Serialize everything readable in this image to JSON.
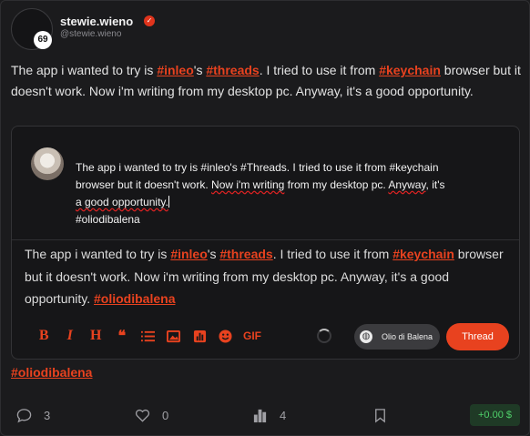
{
  "author": {
    "username": "stewie.wieno",
    "handle": "@stewie.wieno",
    "reputation": "69",
    "verified_icon": "verified-check-icon"
  },
  "post": {
    "segments": [
      {
        "text": "The app i wanted to try is ",
        "tag": false
      },
      {
        "text": "#inleo",
        "tag": true
      },
      {
        "text": "'s ",
        "tag": false
      },
      {
        "text": "#threads",
        "tag": true
      },
      {
        "text": ". I tried to use it from ",
        "tag": false
      },
      {
        "text": "#keychain",
        "tag": true
      },
      {
        "text": " browser but it doesn't work. Now i'm writing from my desktop pc. Anyway, it's a good opportunity.",
        "tag": false
      }
    ],
    "trailing_tag": "#oliodibalena"
  },
  "editor": {
    "draft_line1": "The app i wanted to try is #inleo's #Threads. I tried to use it from #keychain",
    "draft_line2_a": "browser but it doesn't work. ",
    "draft_line2_b": "Now i'm writing",
    "draft_line2_c": " from my desktop pc. ",
    "draft_line2_d": "Anyway",
    "draft_line2_e": ", it's",
    "draft_line3": "a good opportunity.",
    "draft_line4": "#oliodibalena",
    "preview_segments": [
      {
        "text": "The app i wanted to try is ",
        "tag": false
      },
      {
        "text": "#inleo",
        "tag": true
      },
      {
        "text": "'s ",
        "tag": false
      },
      {
        "text": "#threads",
        "tag": true
      },
      {
        "text": ". I tried to use it from ",
        "tag": false
      },
      {
        "text": "#keychain",
        "tag": true
      },
      {
        "text": " browser but it doesn't work. Now i'm writing from my desktop pc. Anyway, it's a good opportunity. ",
        "tag": false
      },
      {
        "text": "#oliodibalena",
        "tag": true
      }
    ],
    "toolbar": {
      "bold": "B",
      "italic": "I",
      "heading": "H",
      "quote": "❝",
      "gif": "GIF"
    },
    "community_label": "Olio di Balena",
    "submit_label": "Thread"
  },
  "stats": {
    "comments": "3",
    "likes": "0",
    "votes": "4",
    "payout": "+0.00 $"
  },
  "colors": {
    "accent": "#e8421f",
    "background": "#1b1b1d",
    "payout_green": "#4fd06a"
  }
}
